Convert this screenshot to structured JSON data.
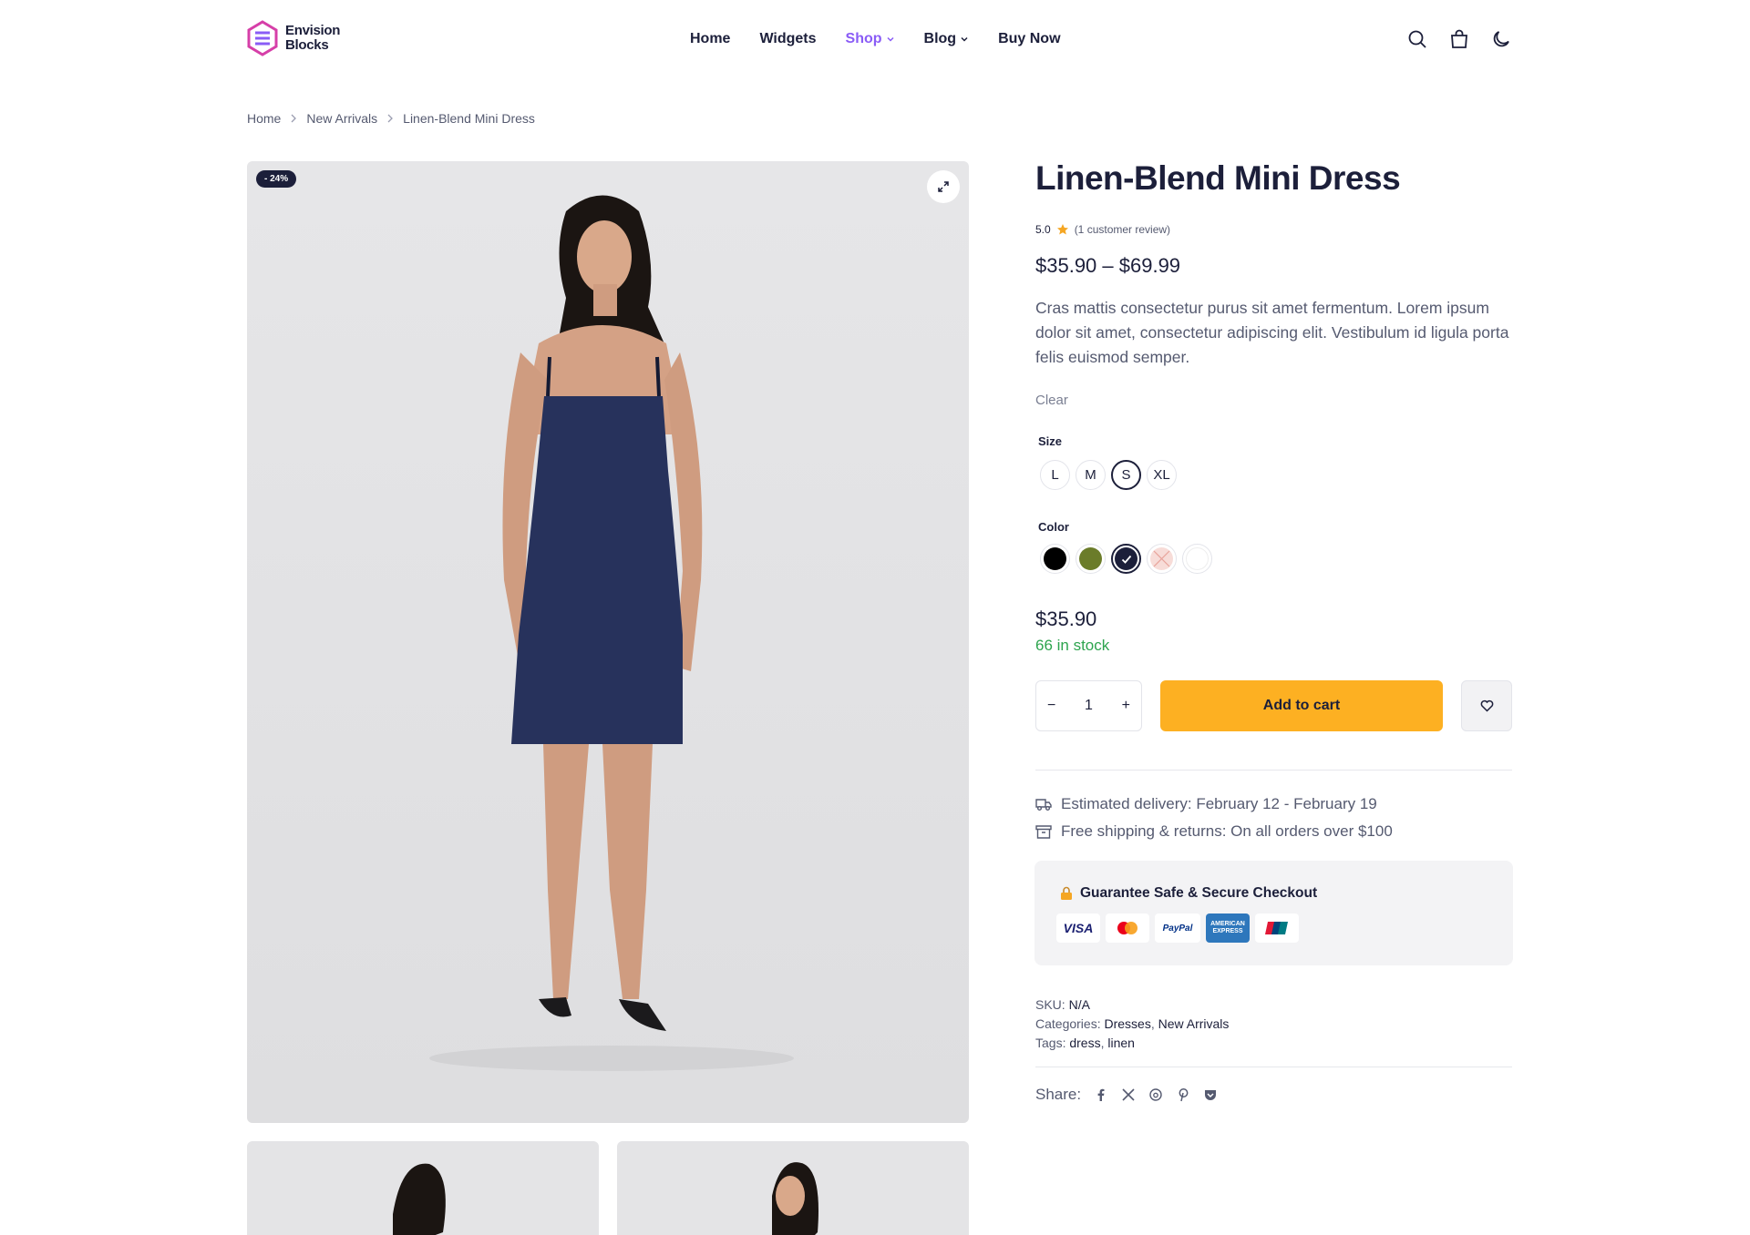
{
  "brand": {
    "line1": "Envision",
    "line2": "Blocks",
    "color": "#d63fa8"
  },
  "nav": [
    {
      "label": "Home"
    },
    {
      "label": "Widgets"
    },
    {
      "label": "Shop"
    },
    {
      "label": "Blog"
    },
    {
      "label": "Buy Now"
    }
  ],
  "header_icons": [
    "search-icon",
    "cart-bag-icon",
    "dark-mode-icon"
  ],
  "breadcrumb": [
    "Home",
    "New Arrivals",
    "Linen-Blend Mini Dress"
  ],
  "gallery": {
    "badge": "- 24%",
    "zoom_icon": "expand-icon",
    "dress_color": "#27325c"
  },
  "product": {
    "title": "Linen-Blend Mini Dress",
    "rating": "5.0",
    "reviews": "(1 customer review)",
    "price_range": "$35.90 – $69.99",
    "description": "Cras mattis consectetur purus sit amet fermentum. Lorem ipsum dolor sit amet, consectetur adipiscing elit. Vestibulum id ligula porta felis euismod semper.",
    "clear": "Clear",
    "size_label": "Size",
    "sizes": [
      "L",
      "M",
      "S",
      "XL"
    ],
    "selected_size": "S",
    "color_label": "Color",
    "colors": [
      "#000000",
      "#6b7c2a",
      "#1c1f3a",
      "#f7dcd8",
      "#ffffff"
    ],
    "price": "$35.90",
    "stock": "66 in stock",
    "quantity": "1",
    "minus": "−",
    "plus": "+",
    "add_to_cart": "Add to cart",
    "delivery": "Estimated delivery: February 12 - February 19",
    "shipping": "Free shipping & returns: On all orders over $100",
    "secure_title": "Guarantee Safe & Secure Checkout",
    "payment_cards": [
      "VISA",
      "Mastercard",
      "PayPal",
      "AMERICAN EXPRESS",
      "UnionPay"
    ],
    "sku_label": "SKU:",
    "sku": "N/A",
    "categories_label": "Categories:",
    "cat1": "Dresses",
    "cat2": "New Arrivals",
    "tags_label": "Tags:",
    "tag1": "dress",
    "tag2": "linen",
    "share_label": "Share:",
    "share_icons": [
      "facebook-icon",
      "x-icon",
      "threads-icon",
      "pinterest-icon",
      "pocket-icon"
    ]
  },
  "colors": {
    "accent": "#8a5cf6",
    "cart": "#fdb022",
    "stock": "#2da44e",
    "text": "#1c1f3a"
  }
}
